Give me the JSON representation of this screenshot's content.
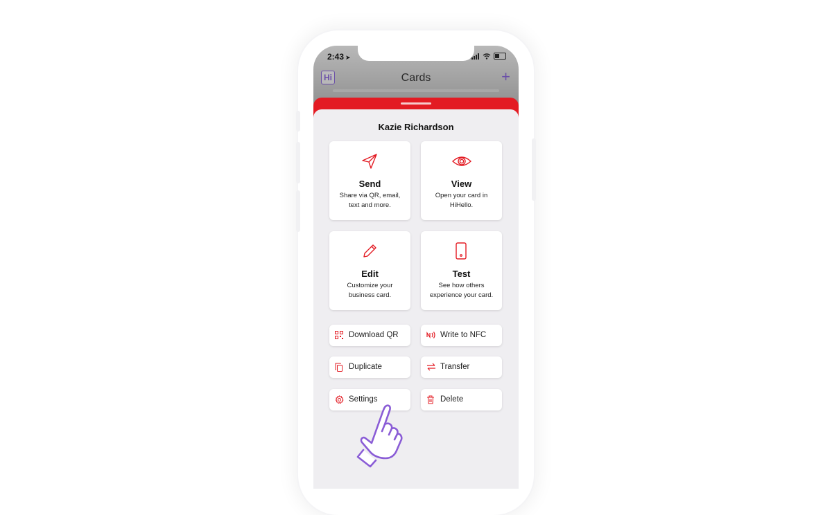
{
  "status_bar": {
    "time": "2:43"
  },
  "nav": {
    "logo": "Hi",
    "title": "Cards",
    "add_label": "+"
  },
  "sheet": {
    "name": "Kazie Richardson",
    "tiles": [
      {
        "title": "Send",
        "desc": "Share via QR, email, text and more.",
        "icon": "send-icon"
      },
      {
        "title": "View",
        "desc": "Open your card in HiHello.",
        "icon": "eye-icon"
      },
      {
        "title": "Edit",
        "desc": "Customize your business card.",
        "icon": "pencil-icon"
      },
      {
        "title": "Test",
        "desc": "See how others experience your card.",
        "icon": "phone-icon"
      }
    ],
    "actions": [
      {
        "label": "Download QR",
        "icon": "qr-code-icon"
      },
      {
        "label": "Write to NFC",
        "icon": "nfc-icon"
      },
      {
        "label": "Duplicate",
        "icon": "copy-icon"
      },
      {
        "label": "Transfer",
        "icon": "transfer-icon"
      },
      {
        "label": "Settings",
        "icon": "gear-icon"
      },
      {
        "label": "Delete",
        "icon": "trash-icon"
      }
    ]
  },
  "colors": {
    "accent_red": "#e31b23",
    "brand_purple": "#6b4fa8",
    "sheet_bg": "#efeef1"
  }
}
